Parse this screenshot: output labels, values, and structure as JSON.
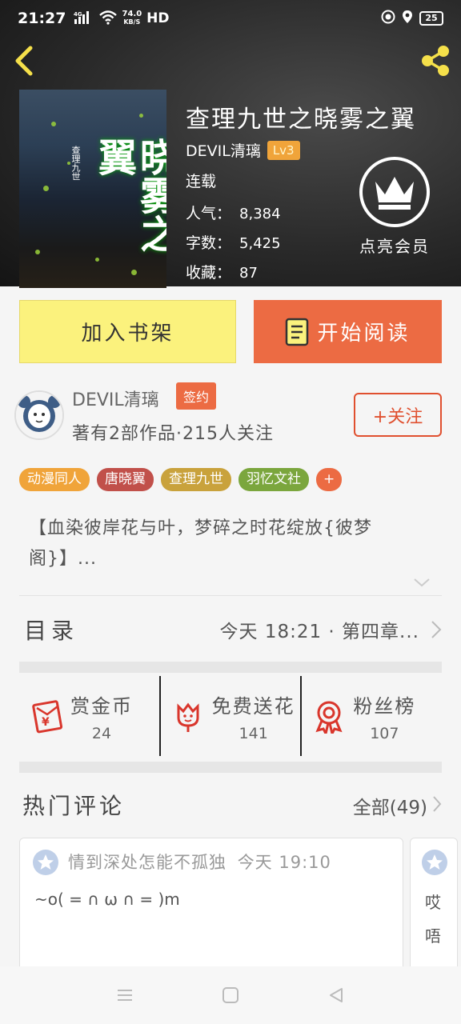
{
  "status_bar": {
    "time": "21:27",
    "network": "4G",
    "speed_value": "74.0",
    "speed_unit": "KB/S",
    "hd": "HD",
    "battery": "25"
  },
  "book": {
    "cover_title": "晓雾之翼",
    "cover_subtitle": "查理九世",
    "title": "查理九世之晓雾之翼",
    "author": "DEVIL清璃",
    "level": "Lv3",
    "serial_status": "连载",
    "stats": [
      {
        "label": "人气：",
        "value": "8,384"
      },
      {
        "label": "字数：",
        "value": "5,425"
      },
      {
        "label": "收藏：",
        "value": "87"
      }
    ],
    "vip_label": "点亮会员"
  },
  "actions": {
    "add_shelf": "加入书架",
    "start_read": "开始阅读"
  },
  "author_section": {
    "name": "DEVIL清璃",
    "badge": "签约",
    "meta": "著有2部作品·215人关注",
    "follow": "+关注"
  },
  "tags": [
    {
      "label": "动漫同人",
      "color": "#f0a43a"
    },
    {
      "label": "唐晓翼",
      "color": "#c1504a"
    },
    {
      "label": "查理九世",
      "color": "#c9a23c"
    },
    {
      "label": "羽忆文社",
      "color": "#7ba63d"
    },
    {
      "label": "+",
      "color": "#ec6b43"
    }
  ],
  "intro": "【血染彼岸花与叶，梦碎之时花绽放{彼梦阁}】...",
  "toc": {
    "label": "目录",
    "latest": "今天 18:21 · 第四章..."
  },
  "rewards": [
    {
      "label": "赏金币",
      "value": "24",
      "icon": "red-envelope-icon"
    },
    {
      "label": "免费送花",
      "value": "141",
      "icon": "flower-icon"
    },
    {
      "label": "粉丝榜",
      "value": "107",
      "icon": "medal-icon"
    }
  ],
  "comments": {
    "title": "热门评论",
    "all": "全部(49)",
    "items": [
      {
        "user": "情到深处怎能不孤独",
        "time": "今天 19:10",
        "body": "~o( = ∩ ω ∩ = )m"
      },
      {
        "line1": "哎",
        "line2": "唔"
      }
    ]
  },
  "colors": {
    "accent": "#ec6b43",
    "shelf_button": "#fbf27d",
    "level_badge": "#f0a43a"
  }
}
